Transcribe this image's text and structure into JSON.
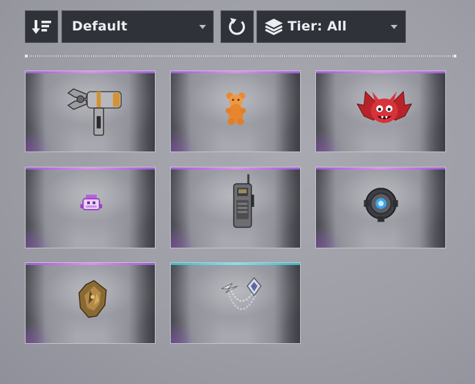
{
  "toolbar": {
    "sort_dropdown": {
      "selected": "Default"
    },
    "tier_dropdown": {
      "selected": "Tier: All"
    }
  },
  "colors": {
    "rarity_purple": "#d070f0",
    "rarity_teal": "#5fd6e0"
  },
  "items": [
    {
      "name": "claw-blaster-badge",
      "icon": "claw-gun-icon",
      "rarity": "purple"
    },
    {
      "name": "gummy-bear-badge",
      "icon": "gummy-bear-icon",
      "rarity": "purple"
    },
    {
      "name": "red-bat-badge",
      "icon": "red-bat-icon",
      "rarity": "purple"
    },
    {
      "name": "pixel-creature-badge",
      "icon": "pixel-creature-icon",
      "rarity": "purple"
    },
    {
      "name": "radio-device-badge",
      "icon": "radio-device-icon",
      "rarity": "purple"
    },
    {
      "name": "reactor-core-badge",
      "icon": "reactor-core-icon",
      "rarity": "purple"
    },
    {
      "name": "bronze-crest-badge",
      "icon": "bronze-crest-icon",
      "rarity": "purple"
    },
    {
      "name": "chain-pin-badge",
      "icon": "chain-pin-icon",
      "rarity": "teal"
    }
  ]
}
